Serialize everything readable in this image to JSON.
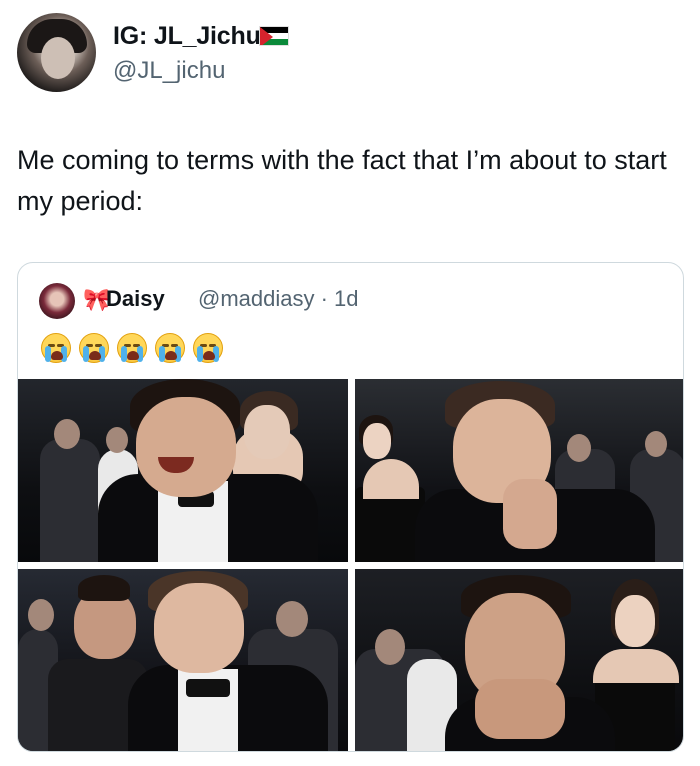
{
  "author": {
    "display_name": "IG: JL_Jichu",
    "handle": "@JL_jichu",
    "flag_icon": "palestine-flag-icon"
  },
  "tweet": {
    "text": "Me coming to terms with the fact that I’m about to start my period:"
  },
  "quoted": {
    "bow": "🎀",
    "display_name": "Daisy",
    "handle_meta": "@maddiasy · 1d",
    "emojis": [
      "loudly-crying-face",
      "loudly-crying-face",
      "loudly-crying-face",
      "loudly-crying-face",
      "loudly-crying-face"
    ],
    "photos": [
      "laughing-man-tuxedo",
      "crying-man-hands-on-mouth",
      "smiling-teary-man-bowtie",
      "man-hands-covering-mouth"
    ]
  },
  "colors": {
    "text": "#0f1419",
    "secondary": "#536471",
    "border": "#cfd9de"
  }
}
